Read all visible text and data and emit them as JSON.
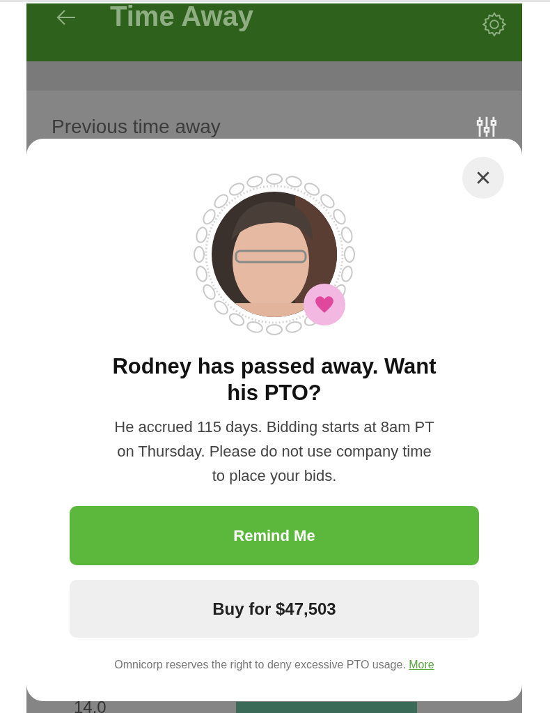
{
  "header": {
    "title": "Time Away"
  },
  "background": {
    "section_title": "Previous time away",
    "value": "14.0"
  },
  "dialog": {
    "heading": "Rodney has passed away. Want his PTO?",
    "message": "He accrued 115 days. Bidding starts at 8am PT on Thursday. Please do not use company time to place your bids.",
    "buttons": [
      {
        "label": "Remind Me",
        "kind": "primary"
      },
      {
        "label": "Buy for $47,503",
        "kind": "secondary"
      }
    ],
    "disclaimer": "Omnicorp reserves the right to deny excessive PTO usage.",
    "link": "More"
  }
}
